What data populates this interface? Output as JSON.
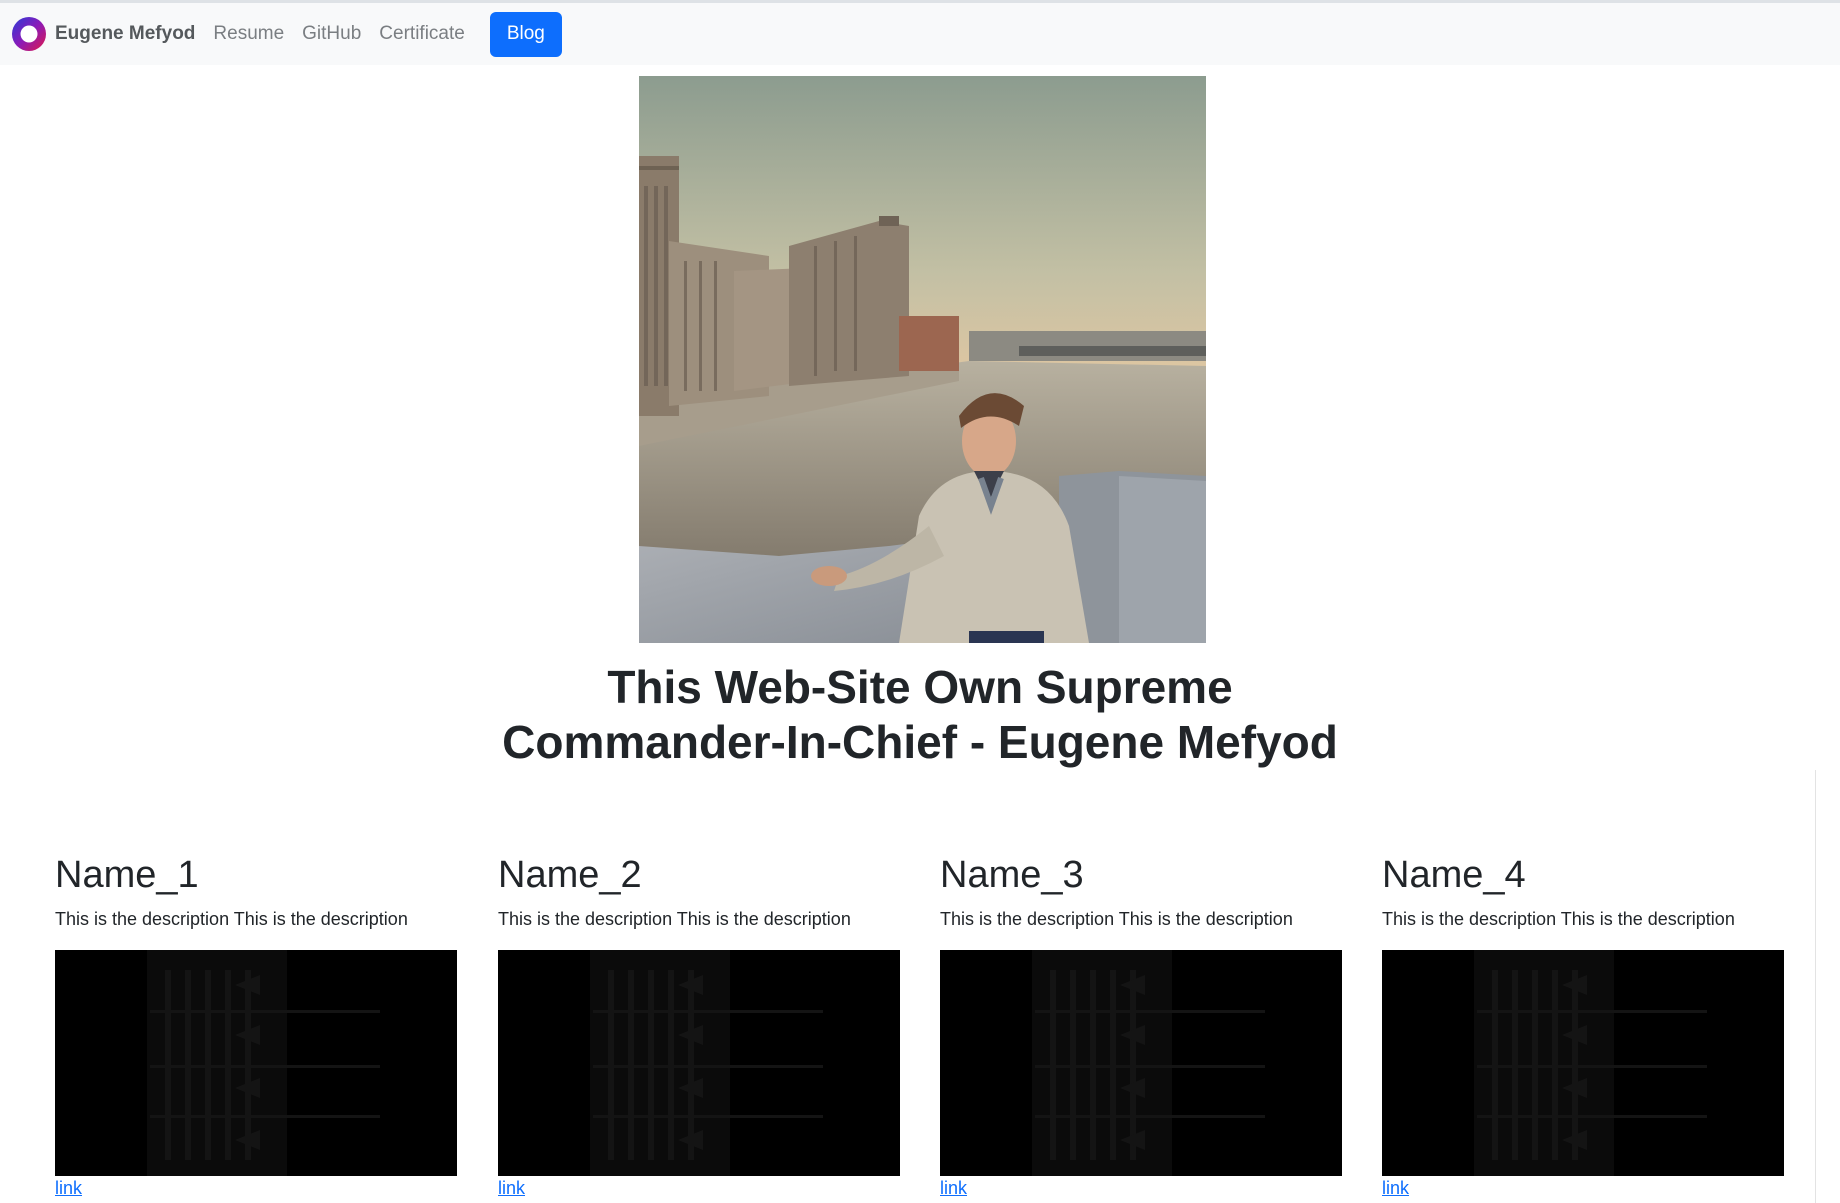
{
  "navbar": {
    "brand": "Eugene Mefyod",
    "links": [
      "Resume",
      "GitHub",
      "Certificate"
    ],
    "button": "Blog"
  },
  "hero": {
    "title_line1": "This Web-Site Own Supreme",
    "title_line2": "Commander-In-Chief - Eugene Mefyod"
  },
  "cards": [
    {
      "title": "Name_1",
      "description": "This is the description This is the description",
      "link": "link"
    },
    {
      "title": "Name_2",
      "description": "This is the description This is the description",
      "link": "link"
    },
    {
      "title": "Name_3",
      "description": "This is the description This is the description",
      "link": "link"
    },
    {
      "title": "Name_4",
      "description": "This is the description This is the description",
      "link": "link"
    }
  ],
  "colors": {
    "accent": "#0d6efd",
    "navbar_bg": "#f8f9fa",
    "text": "#212529"
  }
}
